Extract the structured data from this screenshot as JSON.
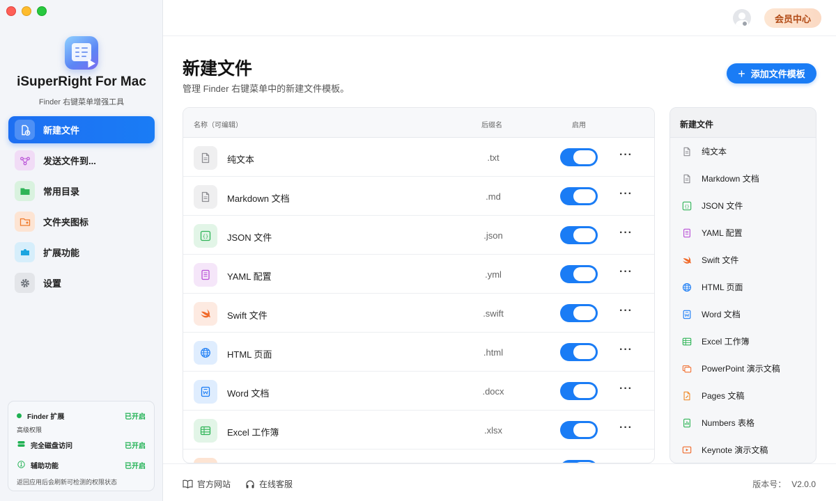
{
  "app": {
    "name": "iSuperRight For Mac",
    "subtitle": "Finder 右键菜单增强工具"
  },
  "sidebar": {
    "items": [
      {
        "label": "新建文件",
        "icon": "new-file-icon",
        "active": true
      },
      {
        "label": "发送文件到...",
        "icon": "share-icon"
      },
      {
        "label": "常用目录",
        "icon": "folder-icon"
      },
      {
        "label": "文件夹图标",
        "icon": "folder-image-icon"
      },
      {
        "label": "扩展功能",
        "icon": "puzzle-icon"
      },
      {
        "label": "设置",
        "icon": "gear-icon"
      }
    ],
    "status": {
      "finder_label": "Finder 扩展",
      "finder_value": "已开启",
      "advanced_label": "高级权限",
      "disk_label": "完全磁盘访问",
      "disk_value": "已开启",
      "access_label": "辅助功能",
      "access_value": "已开启",
      "note": "返回应用后会刷新可检测的权限状态"
    }
  },
  "topbar": {
    "vip_label": "会员中心"
  },
  "main": {
    "title": "新建文件",
    "description": "管理 Finder 右键菜单中的新建文件模板。",
    "add_button": "添加文件模板",
    "columns": {
      "name": "名称（可编辑）",
      "ext": "后缀名",
      "enabled": "启用"
    },
    "rows": [
      {
        "name": "纯文本",
        "ext": ".txt",
        "enabled": true,
        "icon": "text-file-icon",
        "color": "#8e8e93"
      },
      {
        "name": "Markdown 文档",
        "ext": ".md",
        "enabled": true,
        "icon": "markdown-file-icon",
        "color": "#8e8e93"
      },
      {
        "name": "JSON 文件",
        "ext": ".json",
        "enabled": true,
        "icon": "json-file-icon",
        "color": "#2fb457"
      },
      {
        "name": "YAML 配置",
        "ext": ".yml",
        "enabled": true,
        "icon": "yaml-file-icon",
        "color": "#b84fd6"
      },
      {
        "name": "Swift 文件",
        "ext": ".swift",
        "enabled": true,
        "icon": "swift-icon",
        "color": "#f06a2a"
      },
      {
        "name": "HTML 页面",
        "ext": ".html",
        "enabled": true,
        "icon": "globe-icon",
        "color": "#1a7cf5"
      },
      {
        "name": "Word 文档",
        "ext": ".docx",
        "enabled": true,
        "icon": "word-icon",
        "color": "#1a7cf5"
      },
      {
        "name": "Excel 工作簿",
        "ext": ".xlsx",
        "enabled": true,
        "icon": "excel-icon",
        "color": "#2fb457"
      }
    ]
  },
  "preview": {
    "title": "新建文件",
    "items": [
      {
        "label": "纯文本",
        "icon": "text-file-icon",
        "color": "#8e8e93"
      },
      {
        "label": "Markdown 文档",
        "icon": "markdown-file-icon",
        "color": "#8e8e93"
      },
      {
        "label": "JSON 文件",
        "icon": "json-file-icon",
        "color": "#2fb457"
      },
      {
        "label": "YAML 配置",
        "icon": "yaml-file-icon",
        "color": "#b84fd6"
      },
      {
        "label": "Swift 文件",
        "icon": "swift-icon",
        "color": "#f06a2a"
      },
      {
        "label": "HTML 页面",
        "icon": "globe-icon",
        "color": "#1a7cf5"
      },
      {
        "label": "Word 文档",
        "icon": "word-icon",
        "color": "#1a7cf5"
      },
      {
        "label": "Excel 工作簿",
        "icon": "excel-icon",
        "color": "#2fb457"
      },
      {
        "label": "PowerPoint 演示文稿",
        "icon": "powerpoint-icon",
        "color": "#f06a2a"
      },
      {
        "label": "Pages 文稿",
        "icon": "pages-icon",
        "color": "#f08a2a"
      },
      {
        "label": "Numbers 表格",
        "icon": "numbers-icon",
        "color": "#2fb457"
      },
      {
        "label": "Keynote 演示文稿",
        "icon": "keynote-icon",
        "color": "#f06a2a"
      }
    ]
  },
  "footer": {
    "website": "官方网站",
    "support": "在线客服",
    "version_label": "版本号：",
    "version": "V2.0.0"
  },
  "colors": {
    "accent": "#1a7cf5",
    "success": "#1fb152",
    "vip_text": "#b14a15"
  }
}
